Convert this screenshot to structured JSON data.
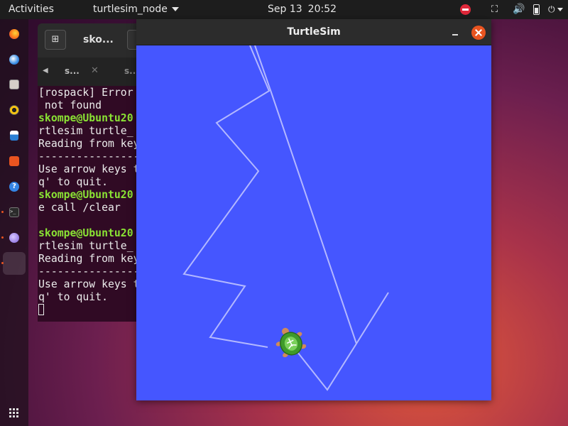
{
  "topbar": {
    "activities": "Activities",
    "app_menu": "turtlesim_node",
    "clock_date": "Sep 13",
    "clock_time": "20:52",
    "icons": [
      "do-not-disturb-icon",
      "network-icon",
      "volume-icon",
      "battery-icon",
      "power-icon"
    ]
  },
  "dock": {
    "apps": [
      "firefox",
      "thunderbird",
      "files",
      "rhythmbox",
      "libreoffice-writer",
      "ubuntu-software",
      "help",
      "terminal",
      "unknown-app",
      "turtlesim"
    ],
    "show_apps_icon": "grid-icon"
  },
  "terminal": {
    "title": "sko...",
    "tabs": [
      {
        "label": "s..."
      },
      {
        "label": "s..."
      }
    ],
    "lines": [
      {
        "text": "[rospack] Error",
        "type": "output"
      },
      {
        "text": " not found",
        "type": "output"
      },
      {
        "text": "skompe@Ubuntu20",
        "type": "prompt"
      },
      {
        "text": "rtlesim turtle_",
        "type": "output"
      },
      {
        "text": "Reading from key",
        "type": "output"
      },
      {
        "text": "----------------",
        "type": "output"
      },
      {
        "text": "Use arrow keys t",
        "type": "output"
      },
      {
        "text": "q' to quit.",
        "type": "output"
      },
      {
        "text": "skompe@Ubuntu20",
        "type": "prompt"
      },
      {
        "text": "e call /clear",
        "type": "output"
      },
      {
        "text": "",
        "type": "output"
      },
      {
        "text": "skompe@Ubuntu20",
        "type": "prompt"
      },
      {
        "text": "rtlesim turtle_",
        "type": "output"
      },
      {
        "text": "Reading from key",
        "type": "output"
      },
      {
        "text": "----------------",
        "type": "output"
      },
      {
        "text": "Use arrow keys t",
        "type": "output"
      },
      {
        "text": "q' to quit.",
        "type": "output"
      }
    ]
  },
  "turtlesim": {
    "title": "TurtleSim",
    "background_color": "#4556ff",
    "pen_color": "#b3b8ff"
  }
}
